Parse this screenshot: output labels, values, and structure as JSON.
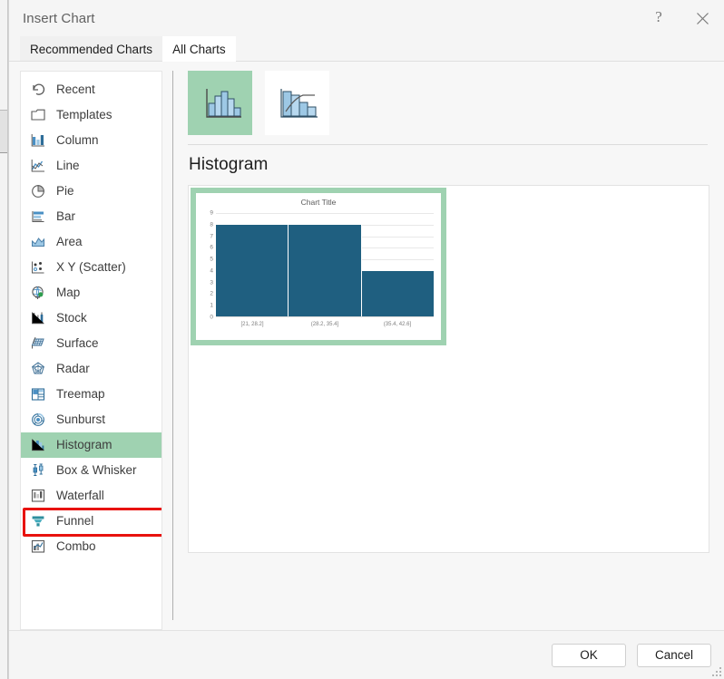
{
  "window": {
    "title": "Insert Chart",
    "help_label": "?",
    "close_label": "×"
  },
  "tabs": [
    {
      "label": "Recommended Charts",
      "active": false
    },
    {
      "label": "All Charts",
      "active": true
    }
  ],
  "sidebar": {
    "items": [
      {
        "label": "Recent",
        "icon": "recent-icon",
        "selected": false
      },
      {
        "label": "Templates",
        "icon": "templates-icon",
        "selected": false
      },
      {
        "label": "Column",
        "icon": "column-icon",
        "selected": false
      },
      {
        "label": "Line",
        "icon": "line-icon",
        "selected": false
      },
      {
        "label": "Pie",
        "icon": "pie-icon",
        "selected": false
      },
      {
        "label": "Bar",
        "icon": "bar-icon",
        "selected": false
      },
      {
        "label": "Area",
        "icon": "area-icon",
        "selected": false
      },
      {
        "label": "X Y (Scatter)",
        "icon": "scatter-icon",
        "selected": false
      },
      {
        "label": "Map",
        "icon": "map-icon",
        "selected": false
      },
      {
        "label": "Stock",
        "icon": "stock-icon",
        "selected": false
      },
      {
        "label": "Surface",
        "icon": "surface-icon",
        "selected": false
      },
      {
        "label": "Radar",
        "icon": "radar-icon",
        "selected": false
      },
      {
        "label": "Treemap",
        "icon": "treemap-icon",
        "selected": false
      },
      {
        "label": "Sunburst",
        "icon": "sunburst-icon",
        "selected": false
      },
      {
        "label": "Histogram",
        "icon": "histogram-icon",
        "selected": true
      },
      {
        "label": "Box & Whisker",
        "icon": "box-whisker-icon",
        "selected": false
      },
      {
        "label": "Waterfall",
        "icon": "waterfall-icon",
        "selected": false
      },
      {
        "label": "Funnel",
        "icon": "funnel-icon",
        "selected": false
      },
      {
        "label": "Combo",
        "icon": "combo-icon",
        "selected": false
      }
    ]
  },
  "main": {
    "subtype_thumbnails": [
      {
        "name": "histogram-subtype",
        "selected": true
      },
      {
        "name": "pareto-subtype",
        "selected": false
      }
    ],
    "type_heading": "Histogram"
  },
  "footer": {
    "ok_label": "OK",
    "cancel_label": "Cancel"
  },
  "colors": {
    "selection_green": "#9fd2b1",
    "annotation_red": "#e8120e",
    "bar_blue": "#1f5f80",
    "icon_blue": "#4a90c4"
  },
  "chart_data": {
    "type": "bar",
    "title": "Chart Title",
    "xlabel": "",
    "ylabel": "",
    "categories": [
      "[21, 28.2]",
      "(28.2, 35.4]",
      "(35.4, 42.6]"
    ],
    "values": [
      8,
      8,
      4
    ],
    "ylim": [
      0,
      9
    ],
    "yticks": [
      0,
      1,
      2,
      3,
      4,
      5,
      6,
      7,
      8,
      9
    ],
    "grid": true,
    "legend": false
  }
}
